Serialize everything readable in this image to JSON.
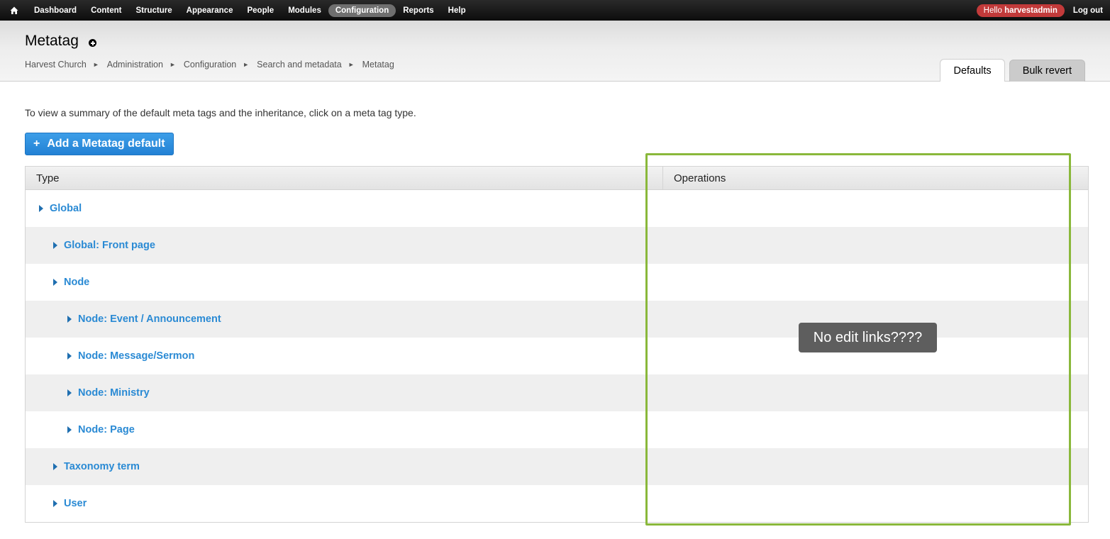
{
  "toolbar": {
    "menu": [
      {
        "label": "Dashboard",
        "active": false
      },
      {
        "label": "Content",
        "active": false
      },
      {
        "label": "Structure",
        "active": false
      },
      {
        "label": "Appearance",
        "active": false
      },
      {
        "label": "People",
        "active": false
      },
      {
        "label": "Modules",
        "active": false
      },
      {
        "label": "Configuration",
        "active": true
      },
      {
        "label": "Reports",
        "active": false
      },
      {
        "label": "Help",
        "active": false
      }
    ],
    "hello_prefix": "Hello ",
    "username": "harvestadmin",
    "logout_label": "Log out"
  },
  "header": {
    "title": "Metatag",
    "breadcrumb": [
      "Harvest Church",
      "Administration",
      "Configuration",
      "Search and metadata",
      "Metatag"
    ],
    "breadcrumb_separator": "►",
    "tabs": [
      {
        "label": "Defaults",
        "active": true
      },
      {
        "label": "Bulk revert",
        "active": false
      }
    ]
  },
  "main": {
    "help_text": "To view a summary of the default meta tags and the inheritance, click on a meta tag type.",
    "add_button_icon": "+",
    "add_button_label": "Add a Metatag default",
    "table": {
      "columns": [
        "Type",
        "Operations"
      ],
      "rows": [
        {
          "label": "Global",
          "depth": 0
        },
        {
          "label": "Global: Front page",
          "depth": 1
        },
        {
          "label": "Node",
          "depth": 1
        },
        {
          "label": "Node: Event / Announcement",
          "depth": 2
        },
        {
          "label": "Node: Message/Sermon",
          "depth": 2
        },
        {
          "label": "Node: Ministry",
          "depth": 2
        },
        {
          "label": "Node: Page",
          "depth": 2
        },
        {
          "label": "Taxonomy term",
          "depth": 1
        },
        {
          "label": "User",
          "depth": 1
        }
      ]
    }
  },
  "annotation": {
    "note": "No edit links????",
    "box_color": "#8ab83b"
  },
  "colors": {
    "link": "#2a8ad4",
    "button": "#2281d4",
    "hello_badge": "#c23a3a"
  }
}
